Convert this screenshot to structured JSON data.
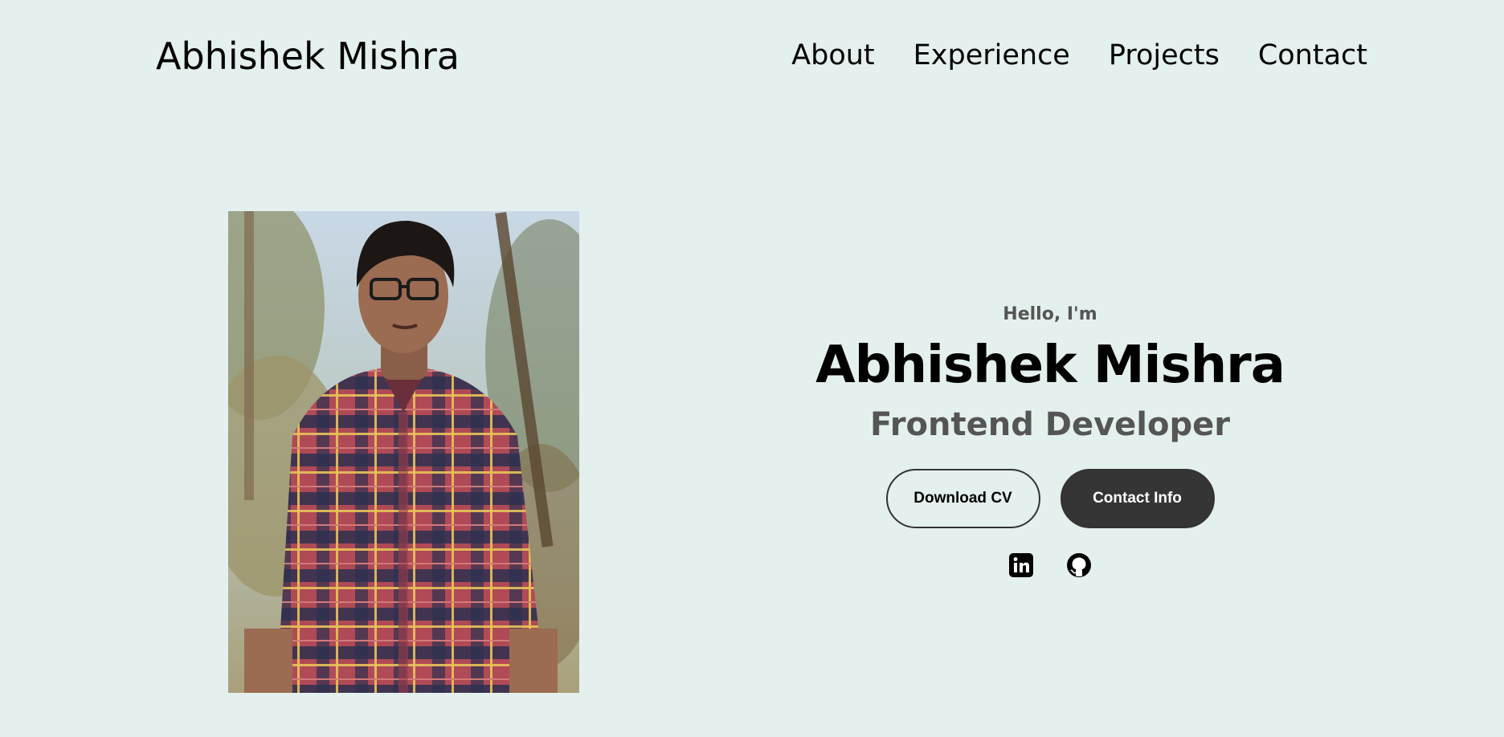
{
  "header": {
    "brand": "Abhishek Mishra",
    "nav": [
      "About",
      "Experience",
      "Projects",
      "Contact"
    ]
  },
  "hero": {
    "greeting": "Hello, I'm",
    "name": "Abhishek Mishra",
    "role": "Frontend Developer",
    "buttons": {
      "download_cv": "Download CV",
      "contact_info": "Contact Info"
    },
    "socials": [
      "linkedin-icon",
      "github-icon"
    ],
    "profile_photo": "profile-photo"
  },
  "colors": {
    "background": "#e4f0ee",
    "heading": "#000000",
    "muted_text": "#555555",
    "button_dark": "#353535"
  }
}
